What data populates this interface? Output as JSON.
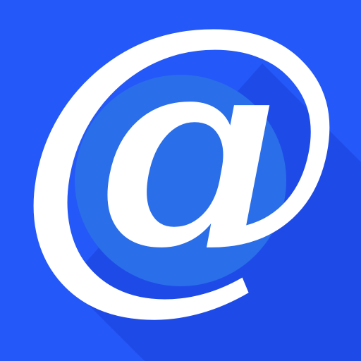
{
  "icon": {
    "name": "email-at-icon",
    "glyph": "@",
    "colors": {
      "background": "#2458F8",
      "background_shade": "#1E4BE8",
      "glyph": "#FFFFFF",
      "glyph_inner": "#2A6EEA"
    }
  }
}
